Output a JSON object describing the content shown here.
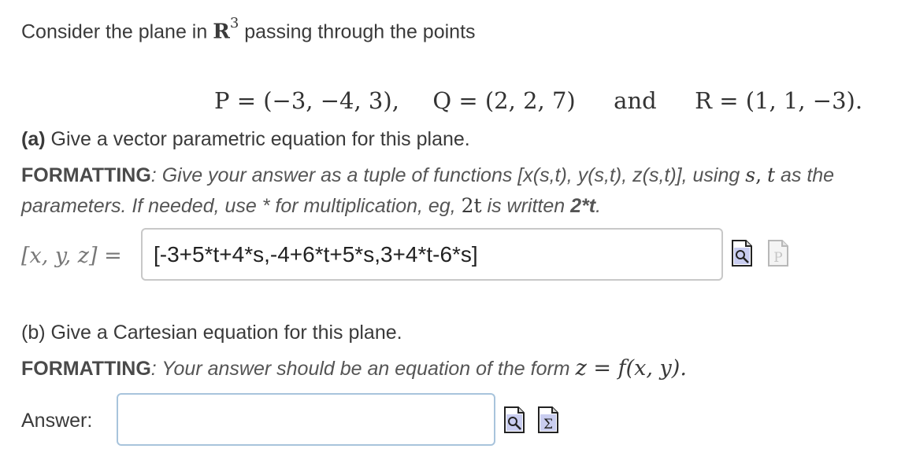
{
  "intro": {
    "before": "Consider the plane in",
    "space": "R",
    "space_exp": "3",
    "after": "passing through the points"
  },
  "points": {
    "P": "P = (−3, −4, 3),",
    "Q": "Q = (2, 2, 7)",
    "and": "and",
    "R": "R = (1, 1, −3)."
  },
  "part_a": {
    "label": "(a)",
    "prompt": "Give a vector parametric equation for this plane.",
    "formatting_label": "FORMATTING",
    "formatting_text_1": ": Give your answer as a tuple of functions [x(s,t), y(s,t), z(s,t)], using",
    "var_s": "s",
    "comma": ",",
    "var_t": "t",
    "formatting_text_2": "as the",
    "formatting_text_3": "parameters. If needed, use * for multiplication, eg,",
    "example_math": "2t",
    "formatting_text_4": "is written",
    "example_code": "2*t",
    "formatting_text_5": ".",
    "answer_label": "[x, y, z] =",
    "answer_value": "[-3+5*t+4*s,-4+6*t+5*s,3+4*t-6*s]",
    "icons": [
      "preview-icon",
      "help-p-icon"
    ]
  },
  "part_b": {
    "prompt": "(b) Give a Cartesian equation for this plane.",
    "formatting_label": "FORMATTING",
    "formatting_text": ": Your answer should be an equation of the form",
    "form_math": "z = f(x, y).",
    "answer_label": "Answer:",
    "answer_value": "",
    "icons": [
      "preview-icon",
      "sigma-icon"
    ]
  }
}
